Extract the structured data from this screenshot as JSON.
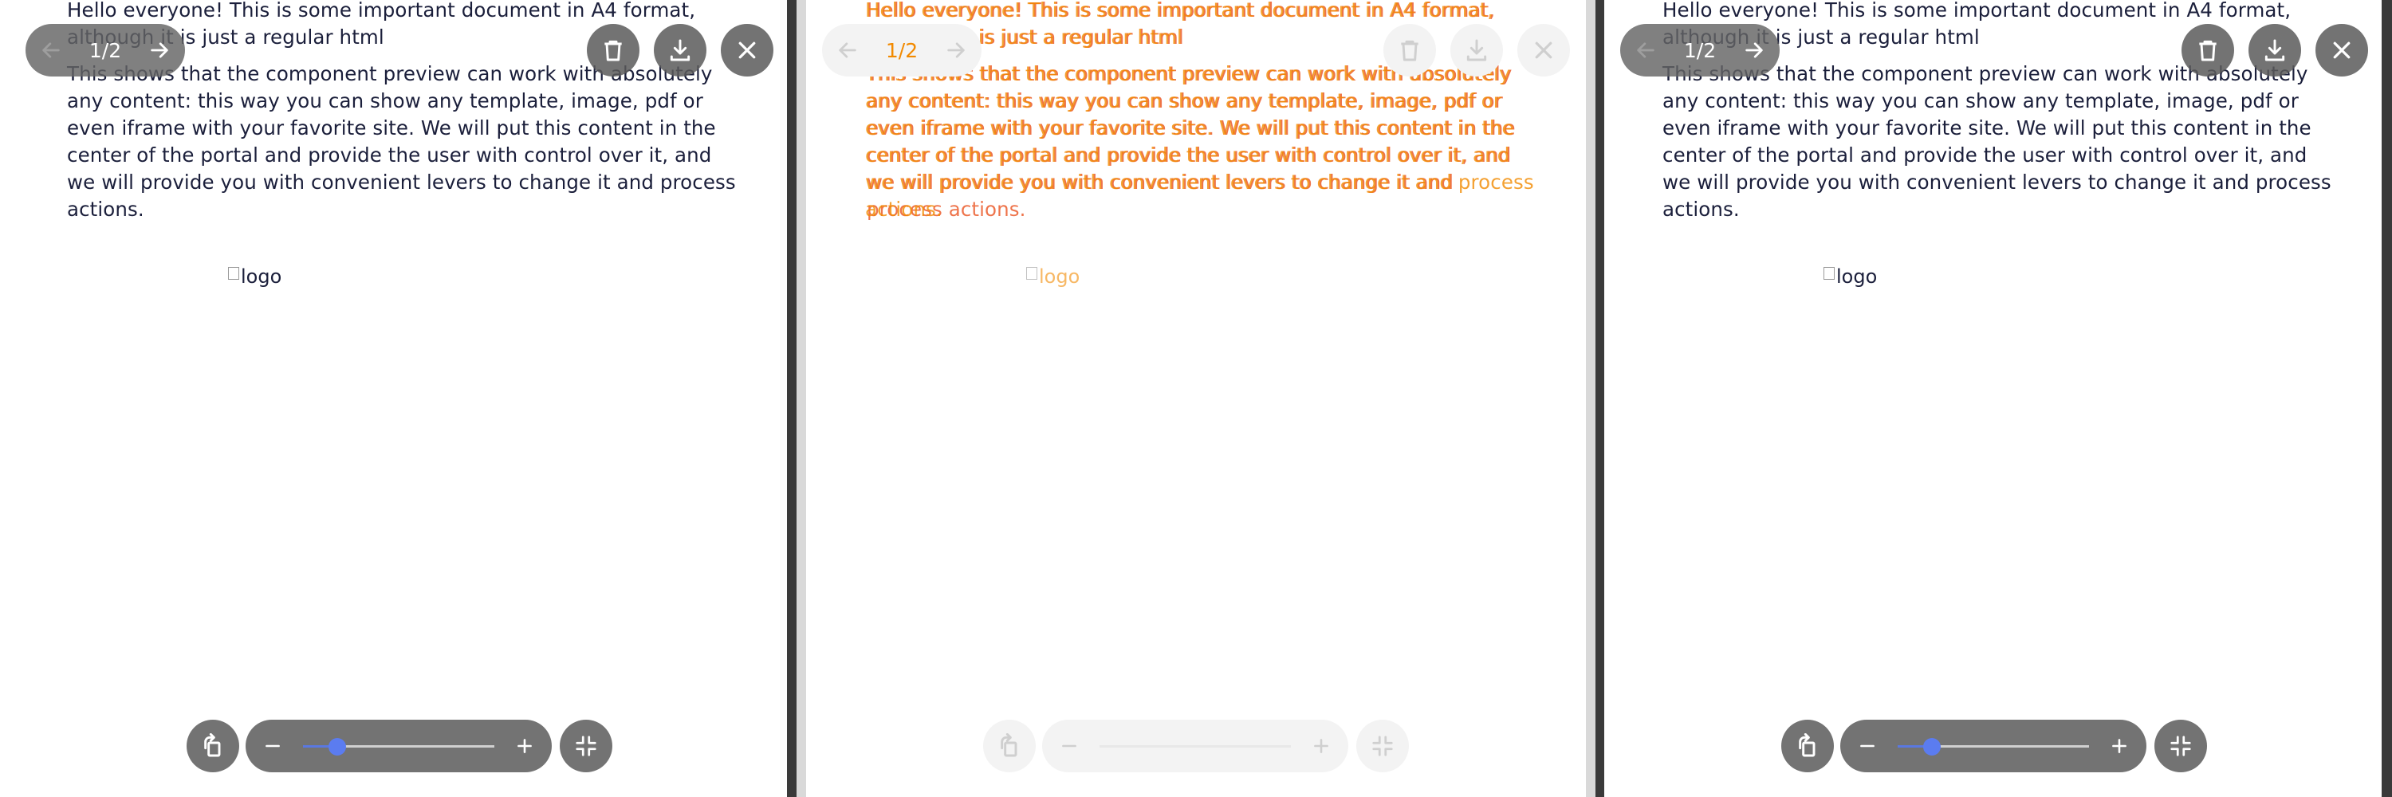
{
  "document": {
    "paragraph1": "Hello everyone! This is some important document in A4 format, although it is just a regular html",
    "paragraph2": "This shows that the component preview can work with absolutely any content: this way you can show any template, image, pdf or even iframe with your favorite site. We will put this content in the center of the portal and provide the user with control over it, and we will provide you with convenient levers to change it and process actions.",
    "logo_alt": "logo"
  },
  "pager": {
    "counter": "1/2"
  },
  "icons": {
    "prev": "arrow-left-icon",
    "next": "arrow-right-icon",
    "delete": "trash-icon",
    "download": "download-icon",
    "close": "close-icon",
    "rotate": "rotate-icon",
    "zoom_out": "minus-icon",
    "zoom_in": "plus-icon",
    "fit": "collapse-icon"
  },
  "zoom": {
    "level": 0.18
  },
  "colors": {
    "toolbar": "#5a5a5a",
    "slider": "#5b7cf0",
    "ghost_text": "#f28a00"
  }
}
